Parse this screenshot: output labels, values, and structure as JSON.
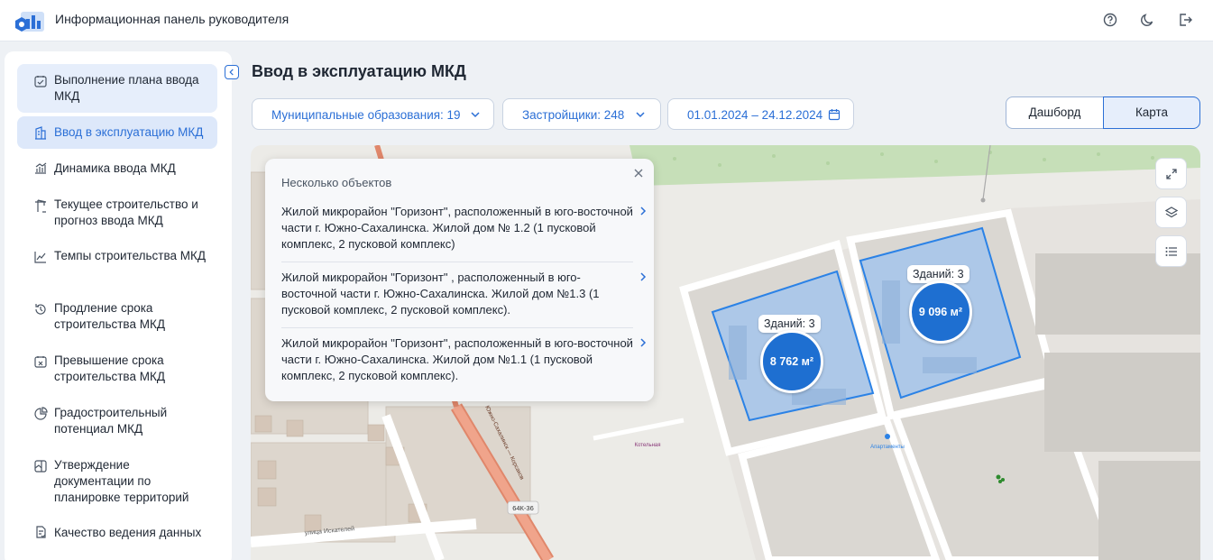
{
  "header": {
    "app_title": "Информационная панель руководителя",
    "icons": [
      "help-icon",
      "moon-icon",
      "logout-icon"
    ]
  },
  "sidebar": {
    "items": [
      {
        "label": "Выполнение плана ввода МКД",
        "icon": "checklist-icon"
      },
      {
        "label": "Ввод в эксплуатацию МКД",
        "icon": "building-icon",
        "active": true
      },
      {
        "label": "Динамика ввода МКД",
        "icon": "bar-growth-icon"
      },
      {
        "label": "Текущее строительство и прогноз ввода МКД",
        "icon": "crane-icon"
      },
      {
        "label": "Темпы строительства МКД",
        "icon": "line-chart-icon"
      },
      {
        "label": "Продление срока строительства МКД",
        "icon": "history-icon"
      },
      {
        "label": "Превышение срока строительства МКД",
        "icon": "calendar-x-icon"
      },
      {
        "label": "Градостроительный потенциал МКД",
        "icon": "pie-icon"
      },
      {
        "label": "Утверждение документации по планировке территорий",
        "icon": "map-doc-icon"
      },
      {
        "label": "Качество ведения данных",
        "icon": "doc-check-icon"
      }
    ]
  },
  "main": {
    "title": "Ввод в эксплуатацию МКД",
    "filters": {
      "municipalities": "Муниципальные образования: 19",
      "developers": "Застройщики: 248",
      "date_range": "01.01.2024 – 24.12.2024"
    },
    "view_toggle": {
      "left": "Дашборд",
      "right": "Карта",
      "selected": "Карта"
    }
  },
  "map": {
    "clusters": [
      {
        "tag": "Зданий: 3",
        "area": "8 762 м²"
      },
      {
        "tag": "Зданий: 3",
        "area": "9 096 м²"
      }
    ],
    "road_label": "64К-36",
    "street_label": "улица Искателей",
    "road_vertical_label": "Южно-Сахалинск — Корсаков",
    "poi_labels": [
      "Апартаменты",
      "Котельная"
    ],
    "controls": [
      "fullscreen-icon",
      "layers-icon",
      "list-icon"
    ]
  },
  "popup": {
    "title": "Несколько объектов",
    "items": [
      "Жилой микрорайон \"Горизонт\", расположенный в юго-восточной части г. Южно-Сахалинска. Жилой дом № 1.2 (1 пусковой комплекс, 2 пусковой комплекс)",
      "Жилой микрорайон \"Горизонт\" , расположенный в юго-восточной части г. Южно-Сахалинска. Жилой дом №1.3 (1 пусковой комплекс, 2 пусковой комплекс).",
      "Жилой микрорайон \"Горизонт\", расположенный в юго-восточной части г. Южно-Сахалинска. Жилой дом №1.1 (1 пусковой комплекс, 2 пусковой комплекс)."
    ]
  },
  "colors": {
    "accent": "#2b6fd6",
    "cluster": "#1e6fd1",
    "highlight": "#e6eefb"
  }
}
